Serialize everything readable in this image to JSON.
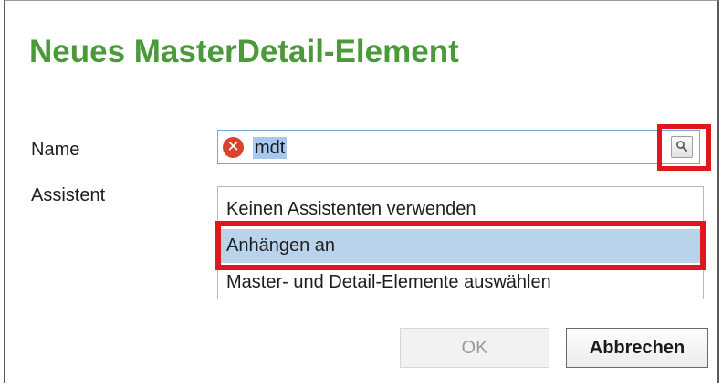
{
  "dialog": {
    "title": "Neues MasterDetail-Element",
    "title_color": "#4a9a3a"
  },
  "form": {
    "name_label": "Name",
    "name_value": "mdt",
    "name_error_icon": "error-x-icon",
    "browse_icon": "search-icon",
    "assistant_label": "Assistent",
    "assistant_options": [
      "Keinen Assistenten verwenden",
      "Anhängen an",
      "Master- und Detail-Elemente auswählen"
    ],
    "selected_option": "Anhängen an"
  },
  "buttons": {
    "ok_label": "OK",
    "ok_enabled": false,
    "cancel_label": "Abbrechen"
  },
  "annotations": {
    "highlight_color": "#e0161e",
    "selection_color": "#b9d4ea"
  }
}
